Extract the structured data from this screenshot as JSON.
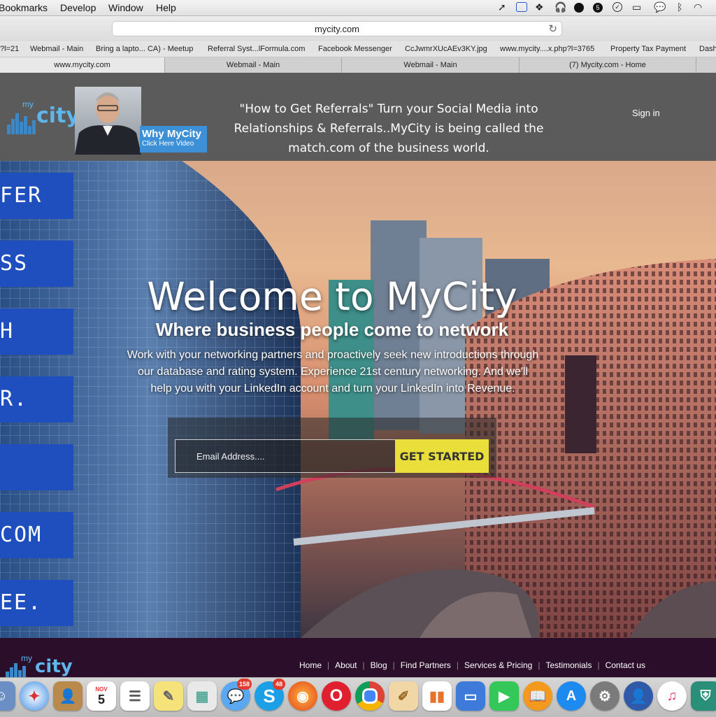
{
  "menubar": {
    "items": [
      "Bookmarks",
      "Develop",
      "Window",
      "Help"
    ],
    "status_icons": [
      "cursor-icon",
      "vpn-icon",
      "dropbox-icon",
      "headphones-icon",
      "dots-icon",
      "shield-5-icon",
      "check-icon",
      "airplay-icon",
      "message-icon",
      "bluetooth-icon",
      "wifi-icon"
    ],
    "shield_number": "5"
  },
  "browser": {
    "url": "mycity.com",
    "favorites": [
      "?l=21",
      "Webmail - Main",
      "Bring a lapto... CA) - Meetup",
      "Referral Syst...lFormula.com",
      "Facebook Messenger",
      "CcJwmrXUcAEv3KY.jpg",
      "www.mycity....x.php?l=3765",
      "Property Tax Payment",
      "Dash"
    ],
    "tabs": [
      "www.mycity.com",
      "Webmail - Main",
      "Webmail - Main",
      "(7) Mycity.com - Home"
    ]
  },
  "header": {
    "logo_my": "my",
    "logo_city": "city",
    "why_line1": "Why MyCity",
    "why_line2": "Click Here Video",
    "headline": "\"How to Get Referrals\" Turn your Social Media into Relationships & Referrals..MyCity is being called the match.com of the business world.",
    "signin": "Sign in"
  },
  "hero": {
    "title": "Welcome to MyCity",
    "subtitle": "Where business people come to network",
    "body": "Work with your networking partners and proactively seek new introductions through our database and rating system. Experience 21st century networking. And we'll help you with your LinkedIn account and turn your LinkedIn into Revenue.",
    "email_placeholder": "Email Address....",
    "cta": "GET STARTED",
    "side_tabs": [
      "FER",
      "SS",
      "H",
      "R.",
      "",
      "COM",
      "EE."
    ]
  },
  "footer": {
    "logo_my": "my",
    "logo_city": "city",
    "nav": [
      "Home",
      "About",
      "Blog",
      "Find Partners",
      "Services & Pricing",
      "Testimonials",
      "Contact us"
    ]
  },
  "dock": {
    "badges": {
      "messages": "158",
      "skype": "48",
      "calendar_month": "NOV",
      "calendar_day": "5"
    }
  }
}
